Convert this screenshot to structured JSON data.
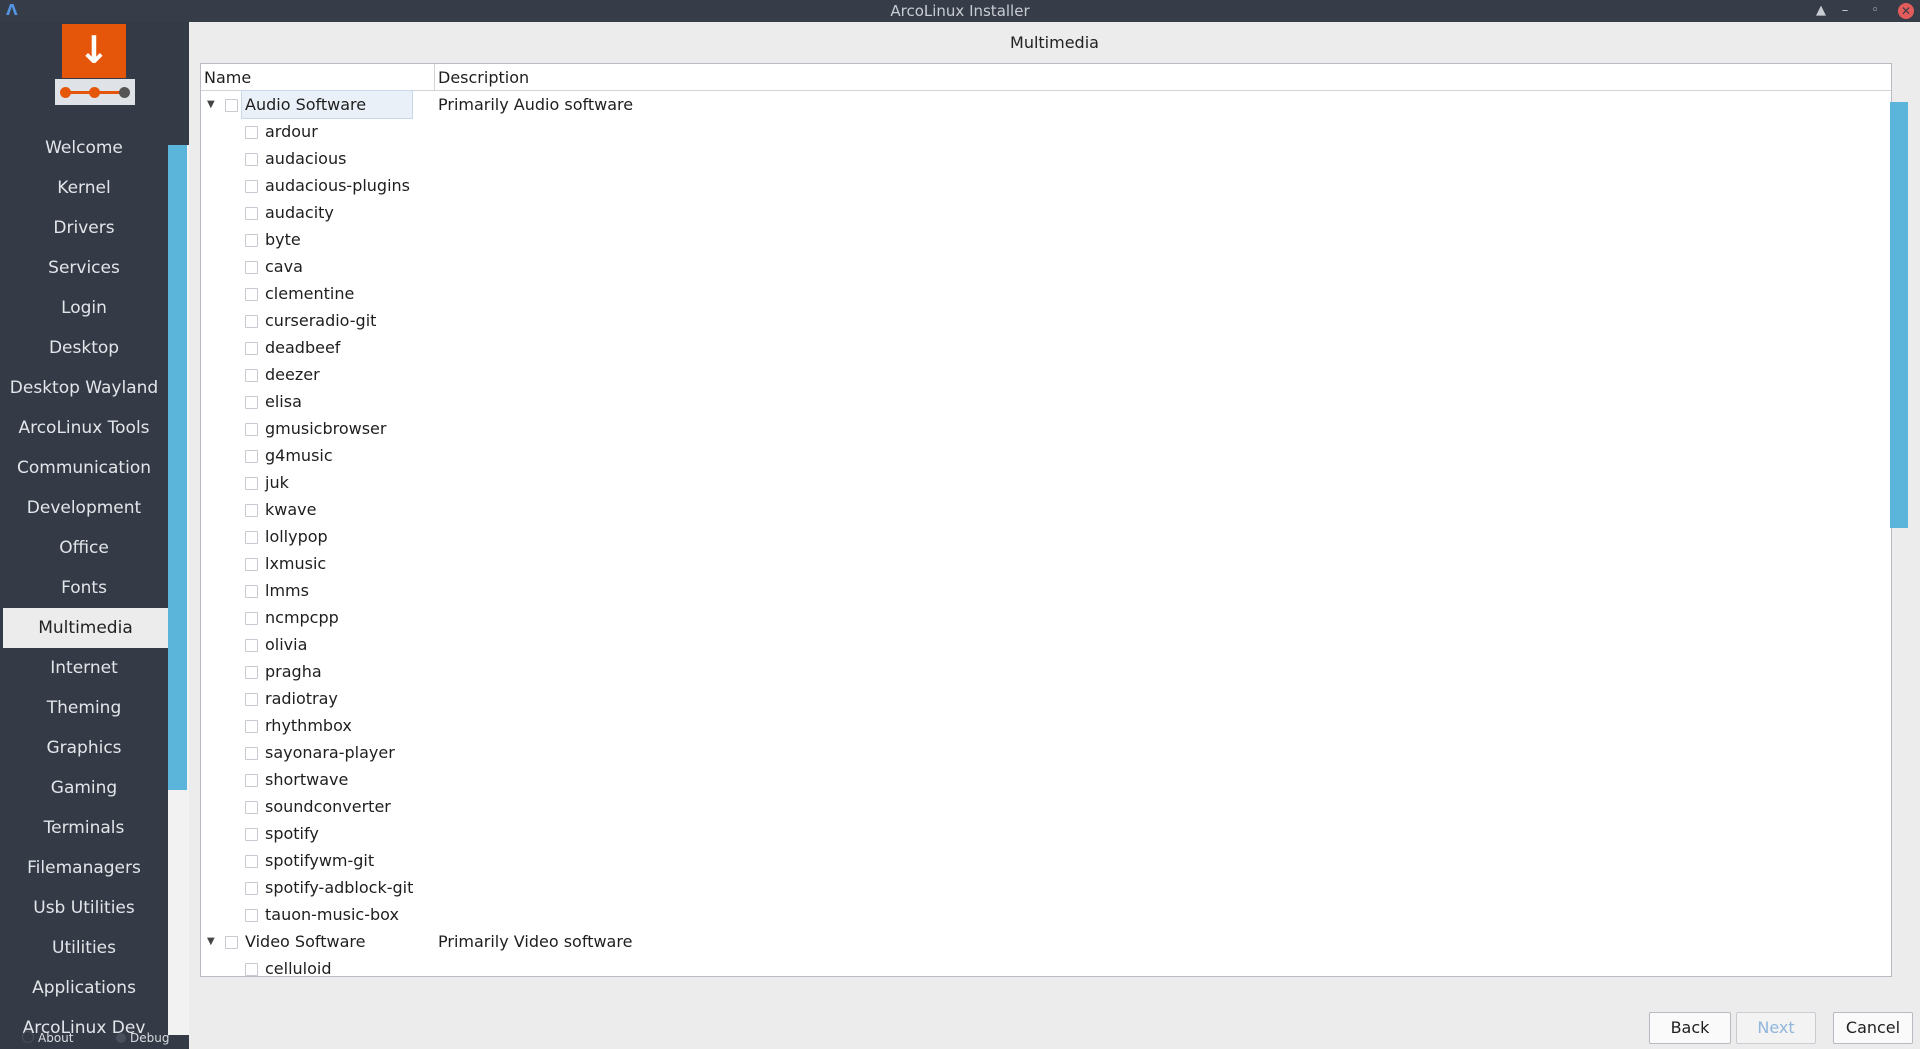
{
  "window": {
    "title": "ArcoLinux Installer",
    "minimize_glyph": "–",
    "maximize_glyph": "◦",
    "close_glyph": "✕",
    "shade_glyph": "▲"
  },
  "sidebar": {
    "items": [
      {
        "label": "Welcome"
      },
      {
        "label": "Kernel"
      },
      {
        "label": "Drivers"
      },
      {
        "label": "Services"
      },
      {
        "label": "Login"
      },
      {
        "label": "Desktop"
      },
      {
        "label": "Desktop Wayland"
      },
      {
        "label": "ArcoLinux Tools"
      },
      {
        "label": "Communication"
      },
      {
        "label": "Development"
      },
      {
        "label": "Office"
      },
      {
        "label": "Fonts"
      },
      {
        "label": "Multimedia"
      },
      {
        "label": "Internet"
      },
      {
        "label": "Theming"
      },
      {
        "label": "Graphics"
      },
      {
        "label": "Gaming"
      },
      {
        "label": "Terminals"
      },
      {
        "label": "Filemanagers"
      },
      {
        "label": "Usb Utilities"
      },
      {
        "label": "Utilities"
      },
      {
        "label": "Applications"
      },
      {
        "label": "ArcoLinux Dev"
      }
    ],
    "active": "Multimedia",
    "footer": {
      "about": "About",
      "debug": "Debug"
    }
  },
  "page": {
    "title": "Multimedia"
  },
  "tree": {
    "columns": {
      "name": "Name",
      "description": "Description"
    },
    "groups": [
      {
        "name": "Audio Software",
        "description": "Primarily Audio software",
        "items": [
          "ardour",
          "audacious",
          "audacious-plugins",
          "audacity",
          "byte",
          "cava",
          "clementine",
          "curseradio-git",
          "deadbeef",
          "deezer",
          "elisa",
          "gmusicbrowser",
          "g4music",
          "juk",
          "kwave",
          "lollypop",
          "lxmusic",
          "lmms",
          "ncmpcpp",
          "olivia",
          "pragha",
          "radiotray",
          "rhythmbox",
          "sayonara-player",
          "shortwave",
          "soundconverter",
          "spotify",
          "spotifywm-git",
          "spotify-adblock-git",
          "tauon-music-box"
        ]
      },
      {
        "name": "Video Software",
        "description": "Primarily Video software",
        "items": [
          "celluloid"
        ]
      }
    ]
  },
  "buttons": {
    "back": "Back",
    "next": "Next",
    "cancel": "Cancel"
  },
  "colors": {
    "accent": "#5bb5db",
    "logo": "#e5560b",
    "sidebar": "#353b46"
  }
}
